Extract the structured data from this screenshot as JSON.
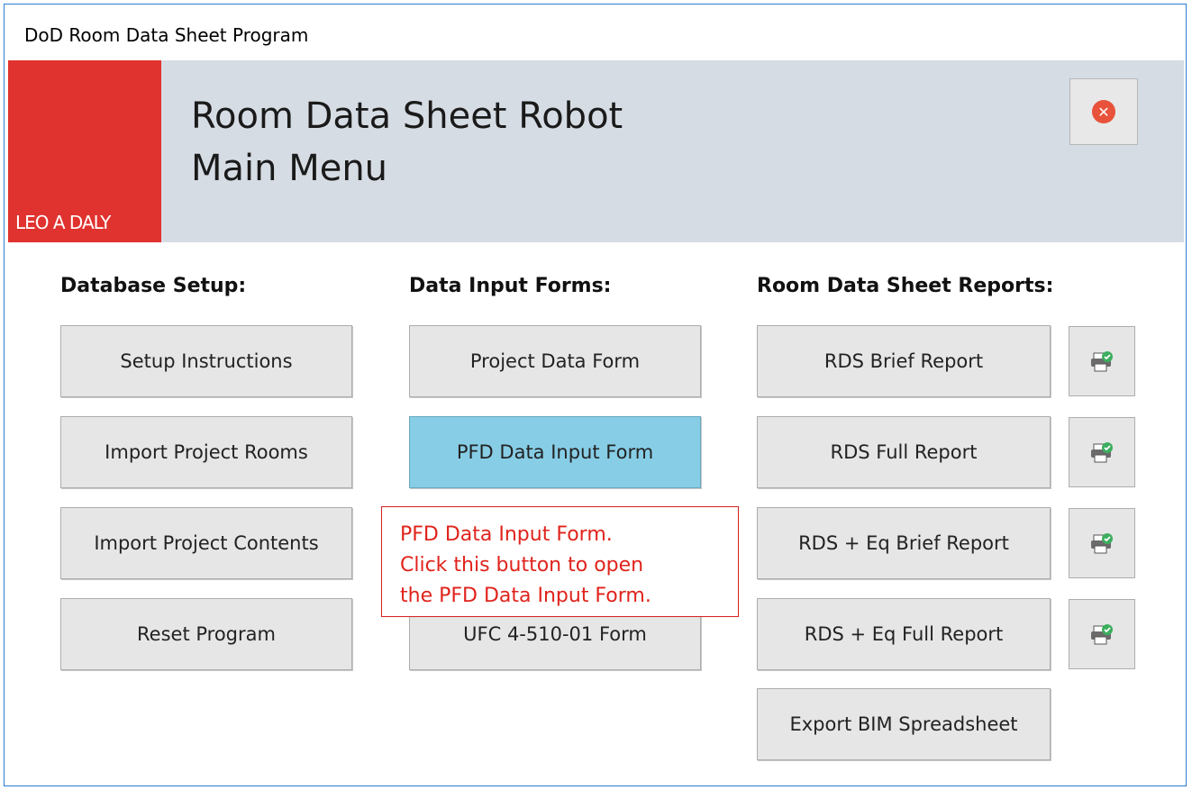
{
  "window": {
    "title": "DoD Room Data Sheet Program"
  },
  "header": {
    "logo_text": "LEO A DALY",
    "title_line1": "Room Data Sheet Robot",
    "title_line2": "Main Menu",
    "close_glyph": "✕",
    "close_icon": "close-circle-icon",
    "accent_color": "#e0322e",
    "banner_color": "#d6dce4"
  },
  "sections": {
    "database_setup": {
      "heading": "Database Setup:",
      "buttons": [
        "Setup Instructions",
        "Import Project Rooms",
        "Import Project Contents",
        "Reset Program"
      ]
    },
    "data_input_forms": {
      "heading": "Data Input Forms:",
      "buttons": [
        "Project Data Form",
        "PFD Data Input Form",
        "UFC 4-510-01 Form"
      ]
    },
    "reports": {
      "heading": "Room Data Sheet Reports:",
      "buttons": [
        "RDS Brief Report",
        "RDS Full Report",
        "RDS + Eq Brief Report",
        "RDS + Eq Full Report",
        "Export BIM Spreadsheet"
      ],
      "print_icon": "print-check-icon"
    }
  },
  "tooltip": {
    "lines": [
      "PFD Data Input Form.",
      "Click this button to open",
      "the PFD Data Input Form."
    ],
    "color": "#e0231c"
  },
  "active_button_color": "#87cde6"
}
